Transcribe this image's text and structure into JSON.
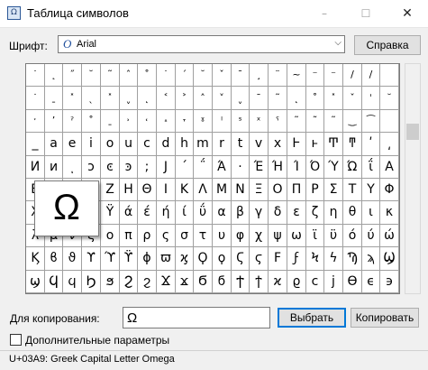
{
  "window": {
    "title": "Таблица символов",
    "app_icon": "character-map-app-icon",
    "minimize": "–",
    "maximize": "☐",
    "close": "✕"
  },
  "font": {
    "label": "Шрифт:",
    "selected": "Arial",
    "icon_glyph": "O",
    "dropdown": "⌵"
  },
  "help_button": "Справка",
  "grid": {
    "columns": 20,
    "rows": [
      [
        "˙",
        "˛",
        "˝",
        "˘",
        "˜",
        "ˆ",
        "˚",
        "˙",
        "´",
        "˘",
        "ˇ",
        "ˉ",
        "¸",
        "¨",
        "~",
        "⁻",
        "⁻",
        "/",
        "/",
        ""
      ],
      [
        "˙",
        "ˍ",
        "˟",
        "ˎ",
        "˟",
        "ˬ",
        "˛",
        "˂",
        "˃",
        "˄",
        "˅",
        "ˬ",
        "ˉ",
        "˜",
        "˛",
        "˚",
        "˟",
        "ˇ",
        "ˈ",
        "˘"
      ],
      [
        "ˑ",
        "ʼ",
        "ˀ",
        "˚",
        "ˍ",
        "˒",
        "˓",
        "˔",
        "˕",
        "ˠ",
        "ˡ",
        "ˢ",
        "ˣ",
        "ˤ",
        "˜",
        "˜",
        "˜",
        "‿",
        "⁀",
        ""
      ],
      [
        "_",
        "a",
        "e",
        "i",
        "o",
        "u",
        "c",
        "d",
        "h",
        "m",
        "r",
        "t",
        "v",
        "x",
        "Ͱ",
        "ͱ",
        "Ͳ",
        "ͳ",
        "ʹ",
        "͵"
      ],
      [
        "Ͷ",
        "ͷ",
        "ͺ",
        "ͻ",
        "ͼ",
        "ͽ",
        ";",
        "Ϳ",
        "΄",
        "΅",
        "Ά",
        "·",
        "Έ",
        "Ή",
        "Ί",
        "Ό",
        "Ύ",
        "Ώ",
        "ΐ",
        "Α"
      ],
      [
        "Β",
        "Γ",
        "Δ",
        "Ε",
        "Ζ",
        "Η",
        "Θ",
        "Ι",
        "Κ",
        "Λ",
        "Μ",
        "Ν",
        "Ξ",
        "Ο",
        "Π",
        "Ρ",
        "Σ",
        "Τ",
        "Υ",
        "Φ"
      ],
      [
        "Χ",
        "Ψ",
        "Ω",
        "Ϊ",
        "Ϋ",
        "ά",
        "έ",
        "ή",
        "ί",
        "ΰ",
        "α",
        "β",
        "γ",
        "δ",
        "ε",
        "ζ",
        "η",
        "θ",
        "ι",
        "κ"
      ],
      [
        "λ",
        "μ",
        "ν",
        "ξ",
        "ο",
        "π",
        "ρ",
        "ς",
        "σ",
        "τ",
        "υ",
        "φ",
        "χ",
        "ψ",
        "ω",
        "ϊ",
        "ϋ",
        "ό",
        "ύ",
        "ώ"
      ],
      [
        "Ϗ",
        "ϐ",
        "ϑ",
        "ϒ",
        "ϓ",
        "ϔ",
        "ϕ",
        "ϖ",
        "ϗ",
        "Ϙ",
        "ϙ",
        "Ϛ",
        "ϛ",
        "Ϝ",
        "ϝ",
        "Ϟ",
        "ϟ",
        "Ϡ",
        "ϡ",
        "Ϣ"
      ],
      [
        "ϣ",
        "Ϥ",
        "ϥ",
        "Ϧ",
        "ϧ",
        "Ϩ",
        "ϩ",
        "Ϫ",
        "ϫ",
        "Ϭ",
        "ϭ",
        "Ϯ",
        "ϯ",
        "ϰ",
        "ϱ",
        "ϲ",
        "ϳ",
        "ϴ",
        "ϵ",
        "϶"
      ]
    ]
  },
  "zoomed_char": "Ω",
  "copy": {
    "label": "Для копирования:",
    "value": "Ω",
    "select_button": "Выбрать",
    "copy_button": "Копировать"
  },
  "advanced_label": "Дополнительные параметры",
  "status": "U+03A9: Greek Capital Letter Omega",
  "colors": {
    "accent": "#0078d7",
    "cell_border": "#a0a0a0"
  }
}
